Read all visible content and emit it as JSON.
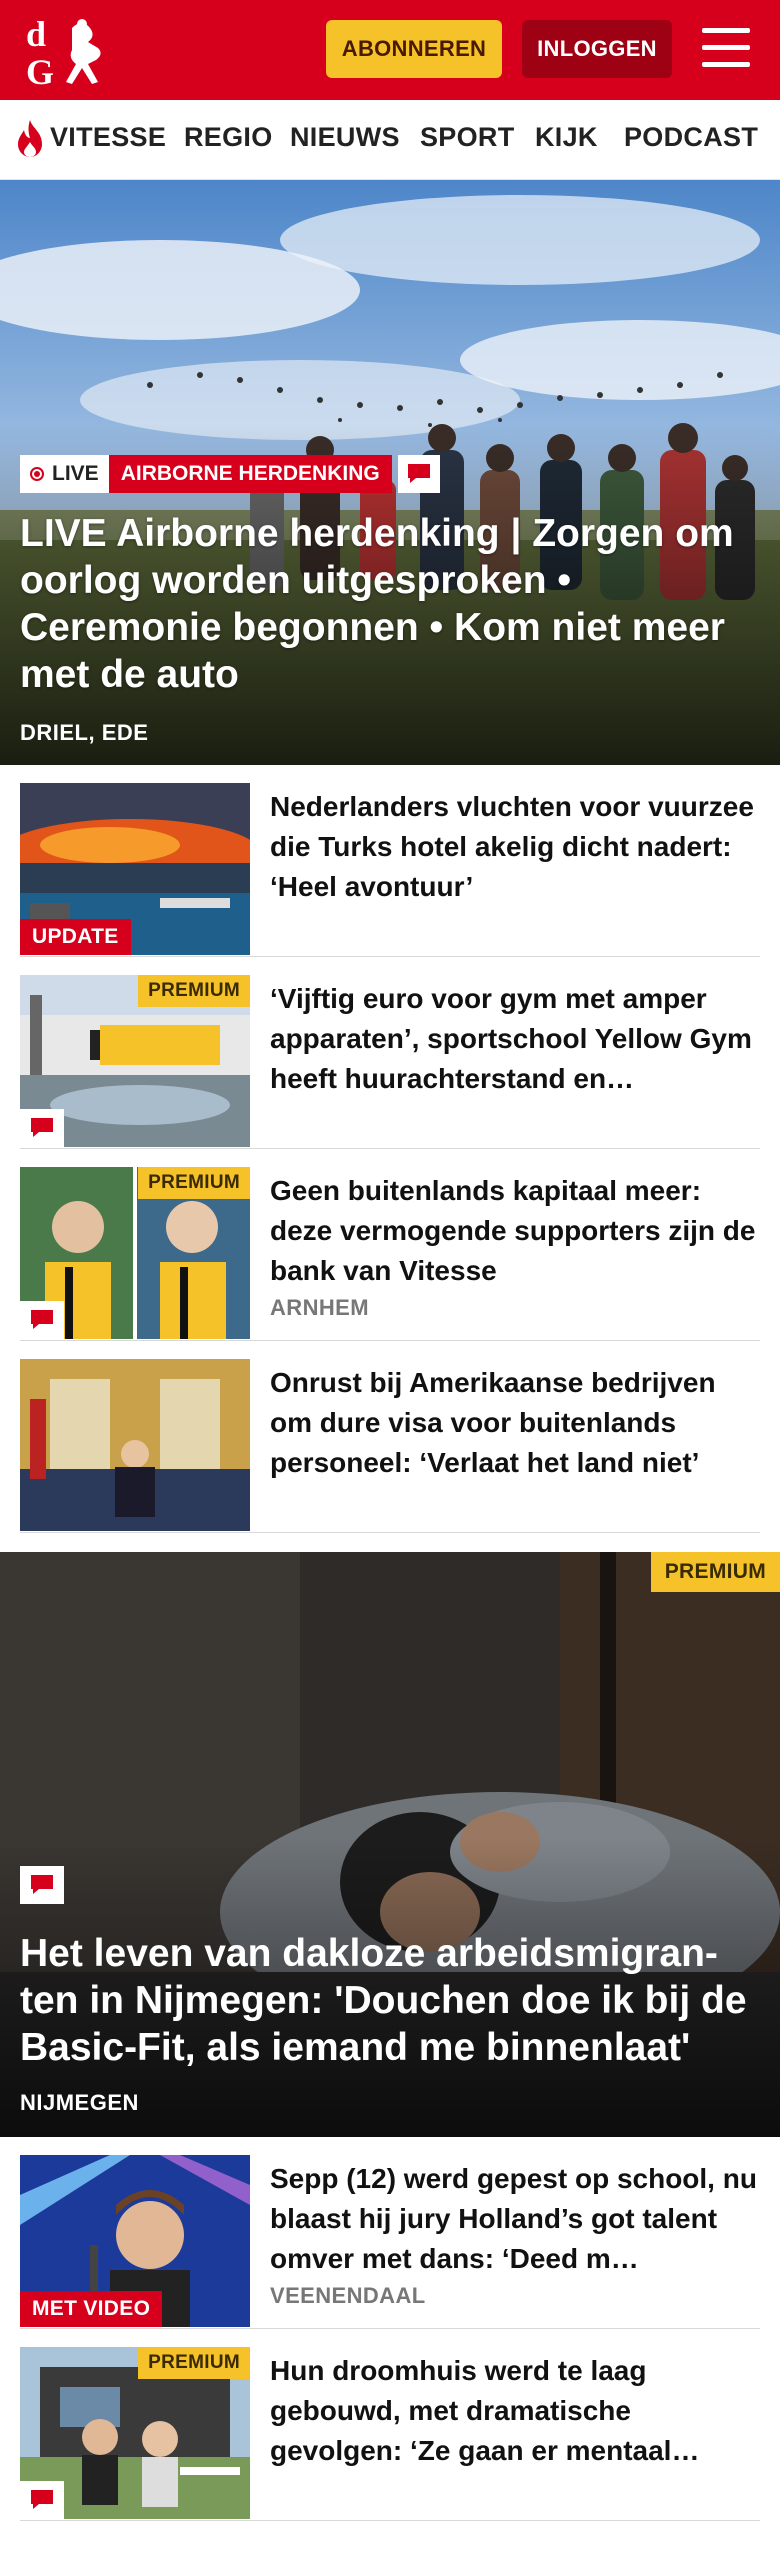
{
  "brand": {
    "name": "De Gelderlander",
    "logo_text": "dG"
  },
  "header": {
    "subscribe_label": "ABONNEREN",
    "login_label": "INLOGGEN"
  },
  "nav": {
    "items": [
      "VITESSE",
      "REGIO",
      "NIEUWS",
      "SPORT",
      "KIJK",
      "PODCAST"
    ]
  },
  "hero": {
    "live_label": "LIVE",
    "topic_label": "AIRBORNE HERDENKING",
    "title": "LIVE Airborne herdenking | Zorgen om oorlog worden uitgesproken • Ceremonie begonnen • Kom niet meer met de auto",
    "location": "DRIEL, EDE"
  },
  "articles": [
    {
      "title": "Nederlanders vluchten voor vuurzee die Turks hotel akelig dicht nadert: ‘Heel avontuur’",
      "badge": "UPDATE",
      "location": ""
    },
    {
      "title": "‘Vijftig euro voor gym met amper apparaten’, sportschool Yellow Gym heeft huurachterstand en…",
      "premium": "PREMIUM",
      "location": ""
    },
    {
      "title": "Geen buitenlands kapitaal meer: deze vermogende supporters zijn de bank van Vitesse",
      "premium": "PREMIUM",
      "location": "ARNHEM"
    },
    {
      "title": "Onrust bij Amerikaanse bedrijven om dure visa voor buitenlands personeel: ‘Verlaat het land niet’",
      "location": ""
    }
  ],
  "feature": {
    "premium": "PREMIUM",
    "title": "Het leven van dakloze arbeidsmigran-ten in Nijmegen: 'Douchen doe ik bij de Basic-Fit, als iemand me binnenlaat'",
    "location": "NIJMEGEN"
  },
  "articles2": [
    {
      "title": "Sepp (12) werd gepest op school, nu blaast hij jury Holland’s got talent omver met dans: ‘Deed m…",
      "badge": "MET VIDEO",
      "location": "VEENENDAAL"
    },
    {
      "title": "Hun droomhuis werd te laag gebouwd, met dramatische gevolgen: ‘Ze gaan er mentaal…",
      "premium": "PREMIUM",
      "location": ""
    }
  ],
  "colors": {
    "brand_red": "#d6001c",
    "premium_yellow": "#f5c22a",
    "login_dark_red": "#9e0014"
  }
}
